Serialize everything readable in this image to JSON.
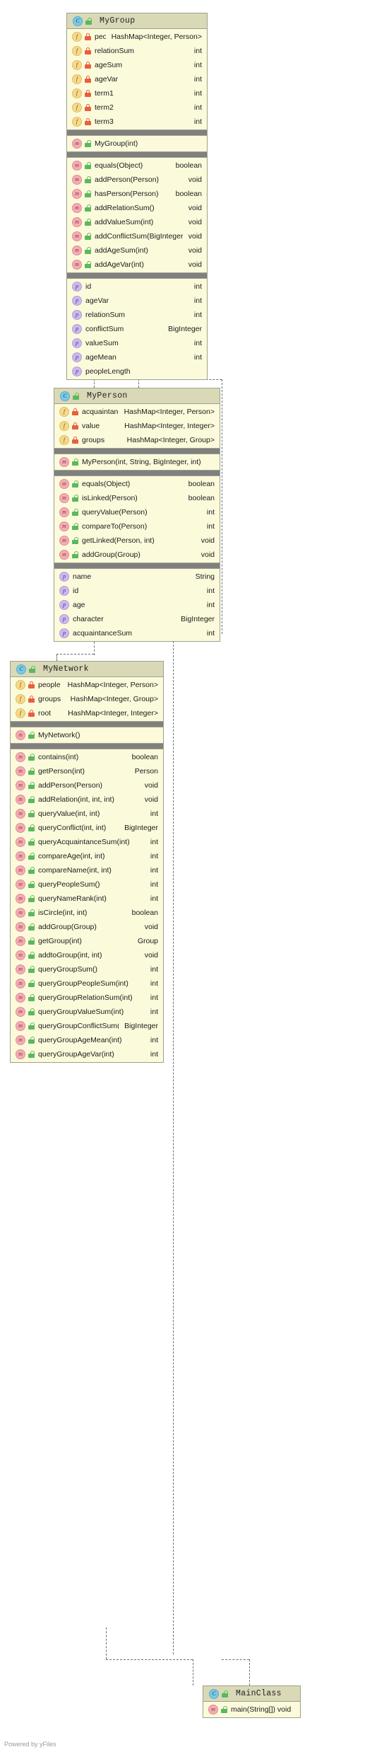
{
  "footer": {
    "text": "Powered by yFiles"
  },
  "icons": {
    "class": "class-icon",
    "field": "field-icon",
    "method": "method-icon",
    "property": "property-icon",
    "lock_private": "lock-closed-icon",
    "lock_public": "lock-open-icon"
  },
  "classes": [
    {
      "id": "mygroup",
      "name": "MyGroup",
      "fields": [
        {
          "name": "people",
          "type": "HashMap<Integer, Person>",
          "vis": "private"
        },
        {
          "name": "relationSum",
          "type": "int",
          "vis": "private"
        },
        {
          "name": "ageSum",
          "type": "int",
          "vis": "private"
        },
        {
          "name": "ageVar",
          "type": "int",
          "vis": "private"
        },
        {
          "name": "term1",
          "type": "int",
          "vis": "private"
        },
        {
          "name": "term2",
          "type": "int",
          "vis": "private"
        },
        {
          "name": "term3",
          "type": "int",
          "vis": "private"
        }
      ],
      "constructors": [
        {
          "name": "MyGroup(int)",
          "type": "",
          "vis": "public"
        }
      ],
      "methods": [
        {
          "name": "equals(Object)",
          "type": "boolean",
          "vis": "public"
        },
        {
          "name": "addPerson(Person)",
          "type": "void",
          "vis": "public"
        },
        {
          "name": "hasPerson(Person)",
          "type": "boolean",
          "vis": "public"
        },
        {
          "name": "addRelationSum()",
          "type": "void",
          "vis": "public"
        },
        {
          "name": "addValueSum(int)",
          "type": "void",
          "vis": "public"
        },
        {
          "name": "addConflictSum(BigInteger)",
          "type": "void",
          "vis": "public"
        },
        {
          "name": "addAgeSum(int)",
          "type": "void",
          "vis": "public"
        },
        {
          "name": "addAgeVar(int)",
          "type": "void",
          "vis": "public"
        }
      ],
      "properties": [
        {
          "name": "id",
          "type": "int"
        },
        {
          "name": "ageVar",
          "type": "int"
        },
        {
          "name": "relationSum",
          "type": "int"
        },
        {
          "name": "conflictSum",
          "type": "BigInteger"
        },
        {
          "name": "valueSum",
          "type": "int"
        },
        {
          "name": "ageMean",
          "type": "int"
        },
        {
          "name": "peopleLength",
          "type": ""
        }
      ]
    },
    {
      "id": "myperson",
      "name": "MyPerson",
      "fields": [
        {
          "name": "acquaintance",
          "type": "HashMap<Integer, Person>",
          "vis": "private"
        },
        {
          "name": "value",
          "type": "HashMap<Integer, Integer>",
          "vis": "private"
        },
        {
          "name": "groups",
          "type": "HashMap<Integer, Group>",
          "vis": "private"
        }
      ],
      "constructors": [
        {
          "name": "MyPerson(int, String, BigInteger, int)",
          "type": "",
          "vis": "public"
        }
      ],
      "methods": [
        {
          "name": "equals(Object)",
          "type": "boolean",
          "vis": "public"
        },
        {
          "name": "isLinked(Person)",
          "type": "boolean",
          "vis": "public"
        },
        {
          "name": "queryValue(Person)",
          "type": "int",
          "vis": "public"
        },
        {
          "name": "compareTo(Person)",
          "type": "int",
          "vis": "public"
        },
        {
          "name": "getLinked(Person, int)",
          "type": "void",
          "vis": "public"
        },
        {
          "name": "addGroup(Group)",
          "type": "void",
          "vis": "public"
        }
      ],
      "properties": [
        {
          "name": "name",
          "type": "String"
        },
        {
          "name": "id",
          "type": "int"
        },
        {
          "name": "age",
          "type": "int"
        },
        {
          "name": "character",
          "type": "BigInteger"
        },
        {
          "name": "acquaintanceSum",
          "type": "int"
        }
      ]
    },
    {
      "id": "mynetwork",
      "name": "MyNetwork",
      "fields": [
        {
          "name": "people",
          "type": "HashMap<Integer, Person>",
          "vis": "private"
        },
        {
          "name": "groups",
          "type": "HashMap<Integer, Group>",
          "vis": "private"
        },
        {
          "name": "root",
          "type": "HashMap<Integer, Integer>",
          "vis": "private"
        }
      ],
      "constructors": [
        {
          "name": "MyNetwork()",
          "type": "",
          "vis": "public"
        }
      ],
      "methods": [
        {
          "name": "contains(int)",
          "type": "boolean",
          "vis": "public"
        },
        {
          "name": "getPerson(int)",
          "type": "Person",
          "vis": "public"
        },
        {
          "name": "addPerson(Person)",
          "type": "void",
          "vis": "public"
        },
        {
          "name": "addRelation(int, int, int)",
          "type": "void",
          "vis": "public"
        },
        {
          "name": "queryValue(int, int)",
          "type": "int",
          "vis": "public"
        },
        {
          "name": "queryConflict(int, int)",
          "type": "BigInteger",
          "vis": "public"
        },
        {
          "name": "queryAcquaintanceSum(int)",
          "type": "int",
          "vis": "public"
        },
        {
          "name": "compareAge(int, int)",
          "type": "int",
          "vis": "public"
        },
        {
          "name": "compareName(int, int)",
          "type": "int",
          "vis": "public"
        },
        {
          "name": "queryPeopleSum()",
          "type": "int",
          "vis": "public"
        },
        {
          "name": "queryNameRank(int)",
          "type": "int",
          "vis": "public"
        },
        {
          "name": "isCircle(int, int)",
          "type": "boolean",
          "vis": "public"
        },
        {
          "name": "addGroup(Group)",
          "type": "void",
          "vis": "public"
        },
        {
          "name": "getGroup(int)",
          "type": "Group",
          "vis": "public"
        },
        {
          "name": "addtoGroup(int, int)",
          "type": "void",
          "vis": "public"
        },
        {
          "name": "queryGroupSum()",
          "type": "int",
          "vis": "public"
        },
        {
          "name": "queryGroupPeopleSum(int)",
          "type": "int",
          "vis": "public"
        },
        {
          "name": "queryGroupRelationSum(int)",
          "type": "int",
          "vis": "public"
        },
        {
          "name": "queryGroupValueSum(int)",
          "type": "int",
          "vis": "public"
        },
        {
          "name": "queryGroupConflictSum(int)",
          "type": "BigInteger",
          "vis": "public"
        },
        {
          "name": "queryGroupAgeMean(int)",
          "type": "int",
          "vis": "public"
        },
        {
          "name": "queryGroupAgeVar(int)",
          "type": "int",
          "vis": "public"
        }
      ],
      "properties": []
    },
    {
      "id": "mainclass",
      "name": "MainClass",
      "fields": [],
      "constructors": [],
      "methods": [
        {
          "name": "main(String[]) void",
          "type": "",
          "vis": "public"
        }
      ],
      "properties": []
    }
  ]
}
